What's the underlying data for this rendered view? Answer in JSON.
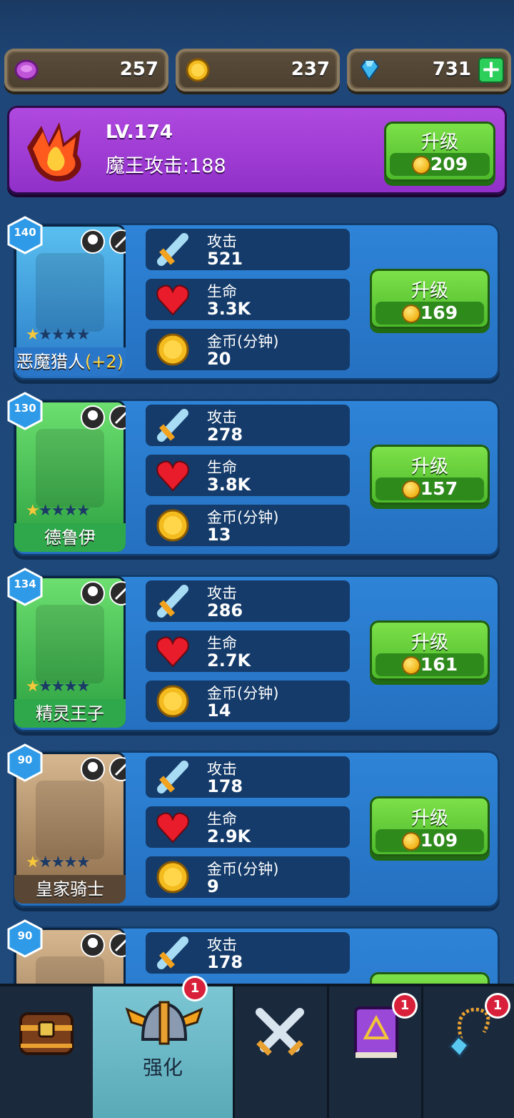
{
  "currencies": {
    "purple": "257",
    "gold": "237",
    "gems": "731"
  },
  "boss": {
    "level": "LV.174",
    "attack": "魔王攻击:188",
    "upgrade_label": "升级",
    "upgrade_cost": "209"
  },
  "stat_labels": {
    "attack": "攻击",
    "hp": "生命",
    "gold": "金币(分钟)"
  },
  "upgrade_label": "升级",
  "heroes": [
    {
      "name": "恶魔猎人",
      "bonus": "(+2)",
      "level": "140",
      "attack": "521",
      "hp": "3.3K",
      "gold": "20",
      "cost": "169",
      "stars": 1,
      "bg": "blue"
    },
    {
      "name": "德鲁伊",
      "bonus": "",
      "level": "130",
      "attack": "278",
      "hp": "3.8K",
      "gold": "13",
      "cost": "157",
      "stars": 1,
      "bg": "green"
    },
    {
      "name": "精灵王子",
      "bonus": "",
      "level": "134",
      "attack": "286",
      "hp": "2.7K",
      "gold": "14",
      "cost": "161",
      "stars": 1,
      "bg": "green"
    },
    {
      "name": "皇家骑士",
      "bonus": "",
      "level": "90",
      "attack": "178",
      "hp": "2.9K",
      "gold": "9",
      "cost": "109",
      "stars": 1,
      "bg": "brown"
    },
    {
      "name": "",
      "bonus": "",
      "level": "90",
      "attack": "178",
      "hp": "",
      "gold": "",
      "cost": "",
      "stars": 0,
      "bg": "brown"
    }
  ],
  "nav": {
    "tabs": [
      {
        "icon": "treasure-chest-icon",
        "label": "",
        "badge": ""
      },
      {
        "icon": "winged-helmet-icon",
        "label": "强化",
        "badge": "1"
      },
      {
        "icon": "crossed-swords-icon",
        "label": "",
        "badge": ""
      },
      {
        "icon": "spell-book-icon",
        "label": "",
        "badge": "1"
      },
      {
        "icon": "amulet-icon",
        "label": "",
        "badge": "1"
      }
    ]
  }
}
